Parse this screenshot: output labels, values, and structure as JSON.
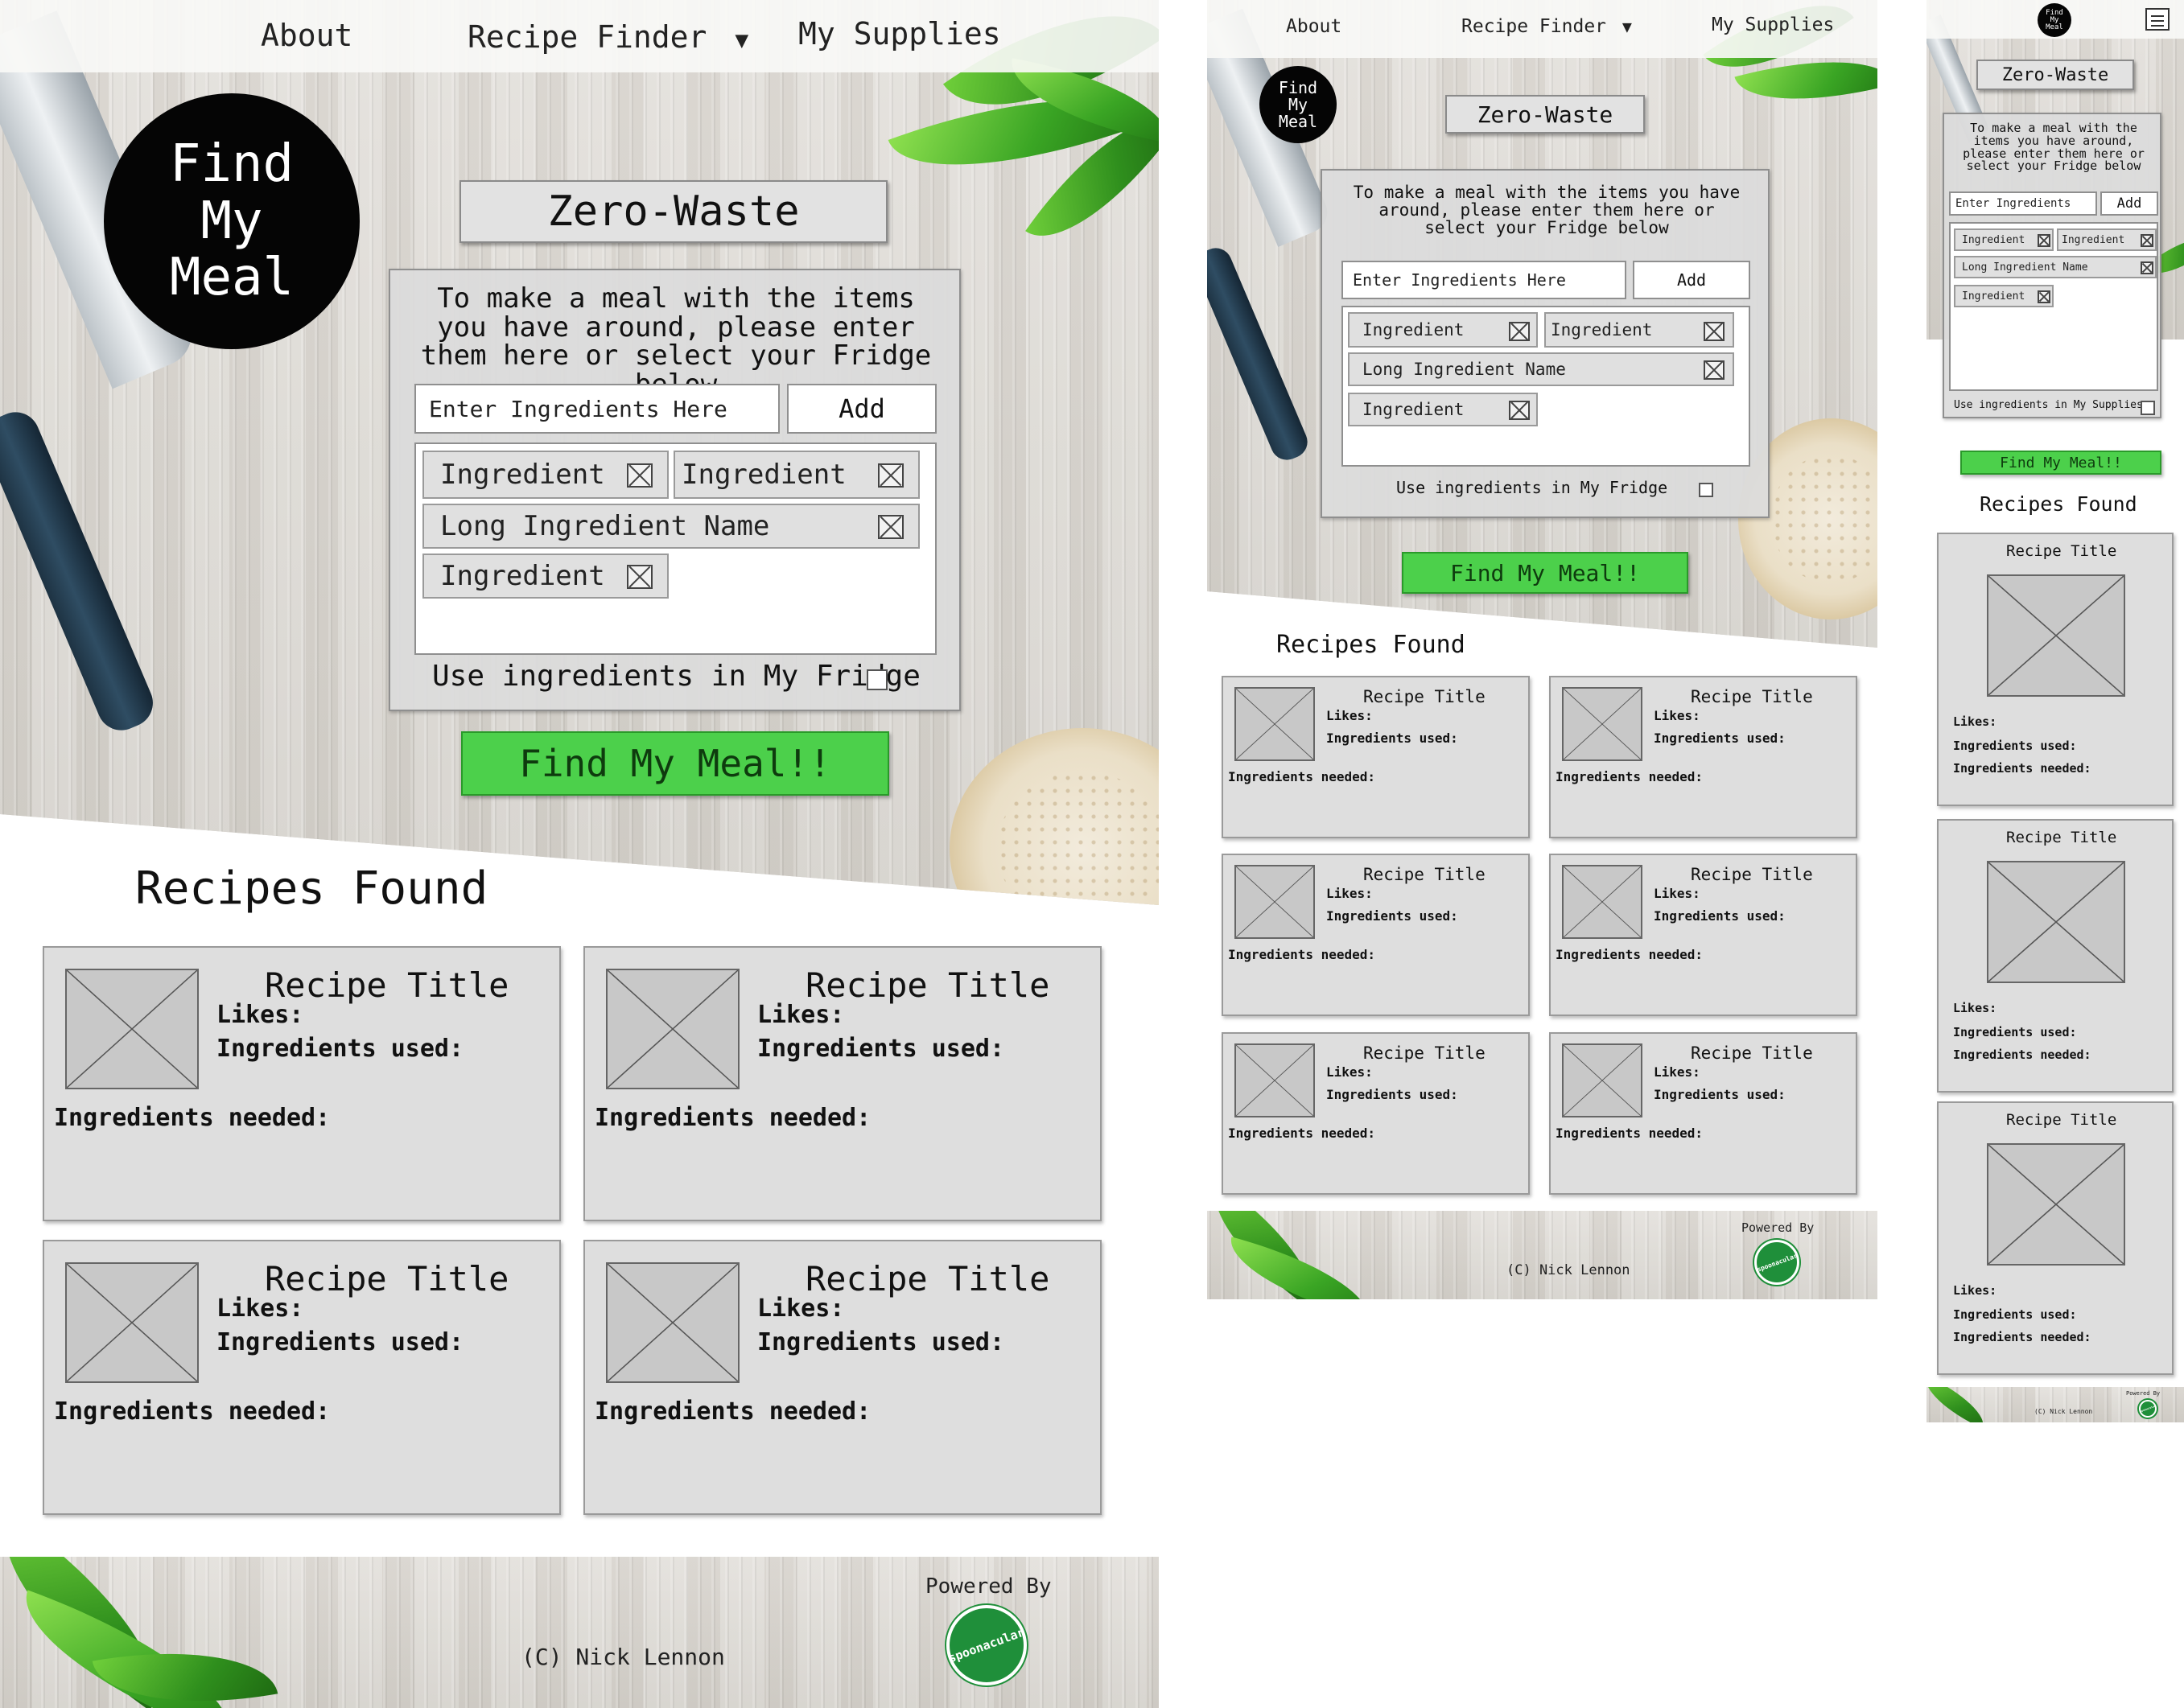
{
  "nav": {
    "about": "About",
    "finder": "Recipe Finder",
    "finder_caret": "▼",
    "supplies": "My Supplies"
  },
  "logo": {
    "line1": "Find",
    "line2": "My",
    "line3": "Meal"
  },
  "search": {
    "title": "Zero-Waste",
    "instructions": "To make a meal with the items you have around, please enter them here or select your Fridge below",
    "input_placeholder": "Enter Ingredients Here",
    "input_placeholder_short": "Enter Ingredients",
    "add_label": "Add",
    "chips": [
      "Ingredient",
      "Ingredient",
      "Long Ingredient Name",
      "Ingredient"
    ],
    "fridge_label": "Use ingredients in My Fridge",
    "supplies_label": "Use ingredients in My Supplies",
    "find_button": "Find My Meal!!"
  },
  "results": {
    "heading": "Recipes Found",
    "card_title": "Recipe Title",
    "likes": "Likes:",
    "used": "Ingredients used:",
    "needed": "Ingredients needed:"
  },
  "footer": {
    "credit": "(C) Nick Lennon",
    "powered": "Powered By",
    "brand": "spoonacular"
  },
  "colors": {
    "accent_green": "#4cd04b",
    "card_gray": "#dedede",
    "panel_gray": "#dcdcdc"
  },
  "icons": [
    "dropdown-caret-icon",
    "remove-x-icon",
    "image-placeholder-icon",
    "hamburger-menu-icon",
    "checkbox-icon",
    "spoonacular-logo"
  ]
}
